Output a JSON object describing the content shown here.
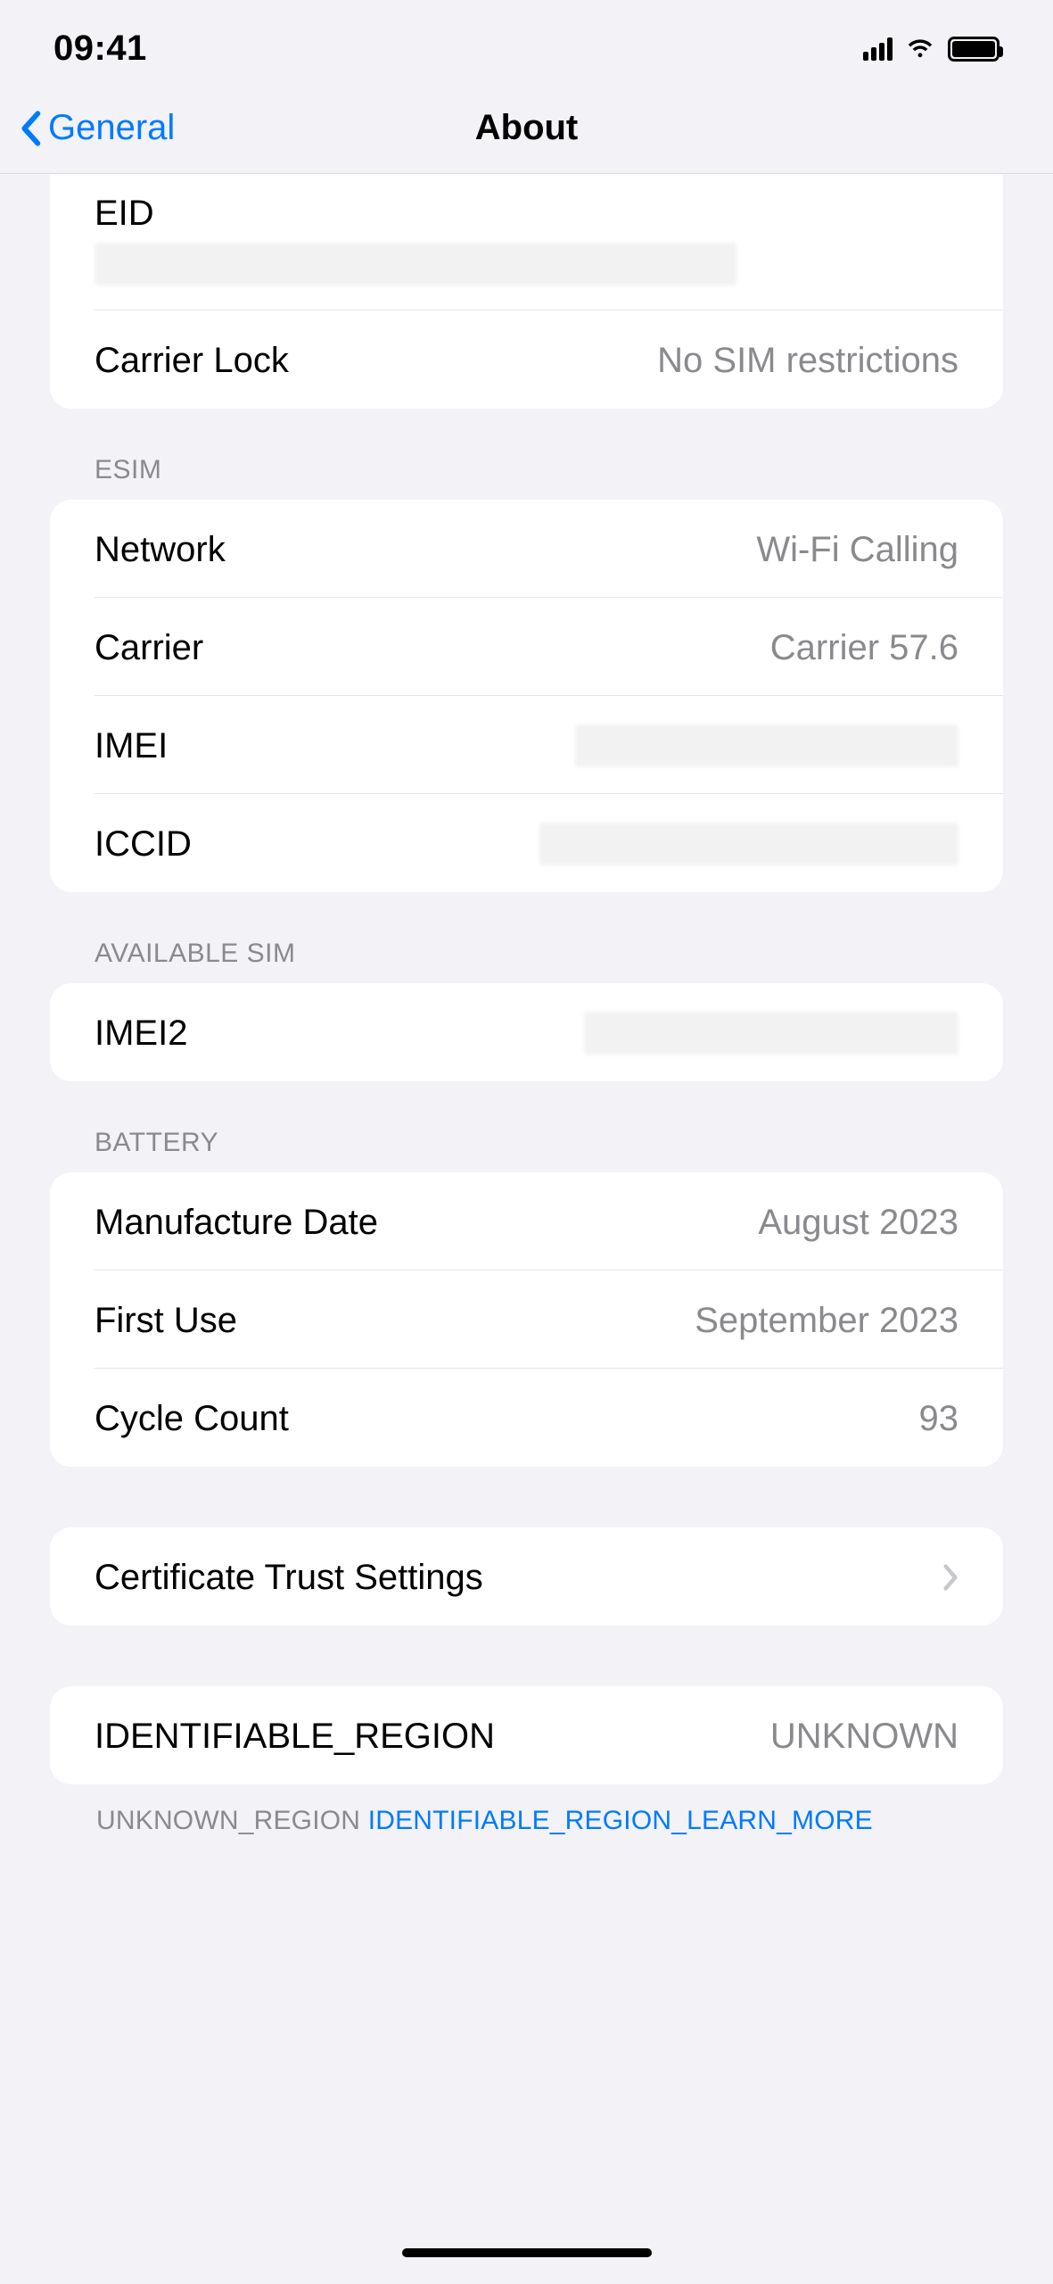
{
  "status": {
    "time": "09:41"
  },
  "nav": {
    "back": "General",
    "title": "About"
  },
  "top_group": {
    "eid_label": "EID",
    "carrier_lock_label": "Carrier Lock",
    "carrier_lock_value": "No SIM restrictions"
  },
  "esim": {
    "header": "ESIM",
    "network_label": "Network",
    "network_value": "Wi-Fi Calling",
    "carrier_label": "Carrier",
    "carrier_value": "Carrier 57.6",
    "imei_label": "IMEI",
    "iccid_label": "ICCID"
  },
  "available_sim": {
    "header": "AVAILABLE SIM",
    "imei2_label": "IMEI2"
  },
  "battery": {
    "header": "BATTERY",
    "manufacture_label": "Manufacture Date",
    "manufacture_value": "August 2023",
    "first_use_label": "First Use",
    "first_use_value": "September 2023",
    "cycle_label": "Cycle Count",
    "cycle_value": "93"
  },
  "cert": {
    "label": "Certificate Trust Settings"
  },
  "region": {
    "label": "IDENTIFIABLE_REGION",
    "value": "UNKNOWN",
    "footer_prefix": "UNKNOWN_REGION ",
    "footer_link": "IDENTIFIABLE_REGION_LEARN_MORE"
  }
}
